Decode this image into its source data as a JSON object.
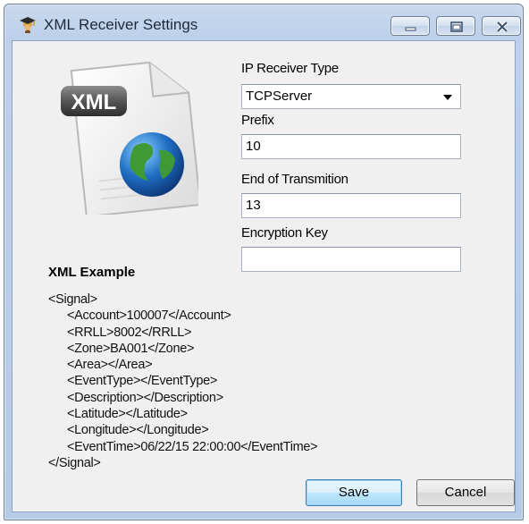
{
  "window": {
    "title": "XML Receiver Settings"
  },
  "icons": {
    "app": "graduate-cap-icon",
    "file": "xml-file-globe-icon",
    "file_badge": "XML"
  },
  "form": {
    "ip_receiver_type": {
      "label": "IP Receiver Type",
      "value": "TCPServer"
    },
    "prefix": {
      "label": "Prefix",
      "value": "10"
    },
    "end_of_transmission": {
      "label": "End of Transmition",
      "value": "13"
    },
    "encryption_key": {
      "label": "Encryption Key",
      "value": ""
    }
  },
  "xml_example": {
    "heading": "XML Example",
    "lines": [
      "<Signal>",
      "<Account>100007</Account>",
      "<RRLL>8002</RRLL>",
      "<Zone>BA001</Zone>",
      "<Area></Area>",
      "<EventType></EventType>",
      "<Description></Description>",
      "<Latitude></Latitude>",
      "<Longitude></Longitude>",
      "<EventTime>06/22/15 22:00:00</EventTime>",
      "</Signal>"
    ]
  },
  "buttons": {
    "save": "Save",
    "cancel": "Cancel"
  }
}
